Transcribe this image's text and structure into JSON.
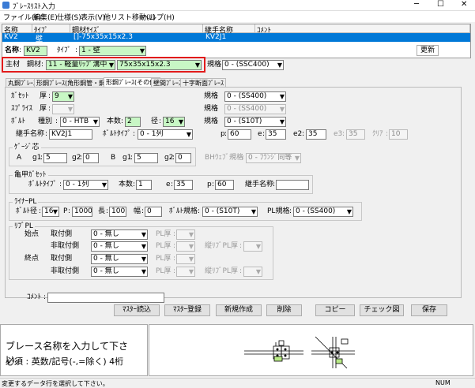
{
  "window": {
    "title": "ﾌﾞﾚｰｽﾘｽﾄ入力"
  },
  "menu": [
    "ファイル(F)",
    "編集(E)",
    "仕様(S)",
    "表示(V)",
    "他リスト移動(L)",
    "ヘルプ(H)"
  ],
  "grid": {
    "headers": [
      "名称",
      "ﾀｲﾌﾟ",
      "鋼材ｻｲｽﾞ",
      "継手名称",
      "ｺﾒﾝﾄ"
    ],
    "row": [
      "KV2",
      "壁",
      "[]-75x35x15x2.3",
      "KV2J1",
      ""
    ]
  },
  "form": {
    "name_label": "名称",
    "name_value": "KV2",
    "type_label": "ﾀｲﾌﾟ",
    "type_value": "1 - 壁",
    "update_label": "更新",
    "main_label": "主材",
    "steel_label": "鋼材",
    "steel_type": "11 - 軽量ﾘｯﾌﾟ溝中",
    "steel_size": "75x35x15x2.3",
    "spec_label": "規格",
    "spec_value": "0 - (SSC400)"
  },
  "tabs": [
    "丸鋼ﾌﾞﾚｰｽ",
    "形鋼ﾌﾞﾚｰｽ(角形鋼管・鋼管)",
    "形鋼ﾌﾞﾚｰｽ(その他)",
    "壁間ﾌﾞﾚｰｽ",
    "十字断面ﾌﾞﾚｰｽ"
  ],
  "panel": {
    "gusset_label": "ｶﾞｾｯﾄ",
    "thick_label": "厚",
    "gusset_thick": "9",
    "gusset_spec_label": "規格",
    "gusset_spec": "0 - (SS400)",
    "splice_label": "ｽﾌﾟﾗｲｽ",
    "splice_thick": "",
    "splice_spec_label": "規格",
    "splice_spec": "0 - (SS400)",
    "bolt_label": "ﾎﾞﾙﾄ",
    "bolt_kind_label": "種別",
    "bolt_kind": "0 - HTB",
    "bolt_count_label": "本数",
    "bolt_count": "2",
    "bolt_dia_label": "径",
    "bolt_dia": "16",
    "bolt_spec_label": "規格",
    "bolt_spec": "0 - (S10T)",
    "joint_name_label": "継手名称",
    "joint_name": "KV2J1",
    "bolt_type_label": "ﾎﾞﾙﾄﾀｲﾌﾟ",
    "bolt_type": "0 - 1列",
    "p_label": "p",
    "p_value": "60",
    "e_label": "e",
    "e_value": "35",
    "e2_label": "e2",
    "e2_value": "35",
    "e3_label": "e3",
    "e3_value": "35",
    "clear_label": "ｸﾘｱ",
    "clear_value": "10"
  },
  "gauge": {
    "title": "ｹﾞｰｼﾞ芯",
    "a_label": "A",
    "g1_label": "g1",
    "a_g1": "5",
    "g2_label": "g2",
    "a_g2": "0",
    "b_label": "B",
    "b_g1": "5",
    "b_g2": "0",
    "bh_label": "BHｳｪﾌﾞ規格",
    "bh_value": "0 - ﾌﾗﾝｼﾞ同等"
  },
  "kikko": {
    "title": "亀甲ｶﾞｾｯﾄ",
    "bolt_type_label": "ﾎﾞﾙﾄﾀｲﾌﾟ",
    "bolt_type": "0 - 1列",
    "count_label": "本数",
    "count": "1",
    "e_label": "e",
    "e_value": "35",
    "p_label": "p",
    "p_value": "60",
    "joint_label": "継手名称",
    "joint_value": ""
  },
  "liner": {
    "title": "ﾗｲﾅｰPL",
    "dia_label": "ﾎﾞﾙﾄ径",
    "dia": "16",
    "p_label": "P",
    "p_value": "1000",
    "len_label": "長",
    "len_value": "100",
    "width_label": "幅",
    "width_value": "0",
    "bolt_spec_label": "ﾎﾞﾙﾄ規格",
    "bolt_spec": "0 - (S10T)",
    "pl_spec_label": "PL規格",
    "pl_spec": "0 - (SS400)"
  },
  "rib": {
    "title": "ﾘﾌﾞPL",
    "start_label": "始点",
    "end_label": "終点",
    "mount_label": "取付側",
    "non_mount_label": "非取付側",
    "none": "0 - 無し",
    "pl_thick_label": "PL厚",
    "vert_rib_label": "縦ﾘﾌﾞPL厚"
  },
  "comment_label": "ｺﾒﾝﾄ",
  "buttons": [
    "ﾏｽﾀｰ読込",
    "ﾏｽﾀｰ登録",
    "新規作成",
    "削除",
    "コピー",
    "チェック図",
    "保存"
  ],
  "message": {
    "line1": "ブレース名称を入力して下さい。",
    "line2": "必須 : 英数/記号(-,=除く) 4桁"
  },
  "status": {
    "text": "変更するデータ行を選択して下さい。",
    "num": "NUM"
  }
}
